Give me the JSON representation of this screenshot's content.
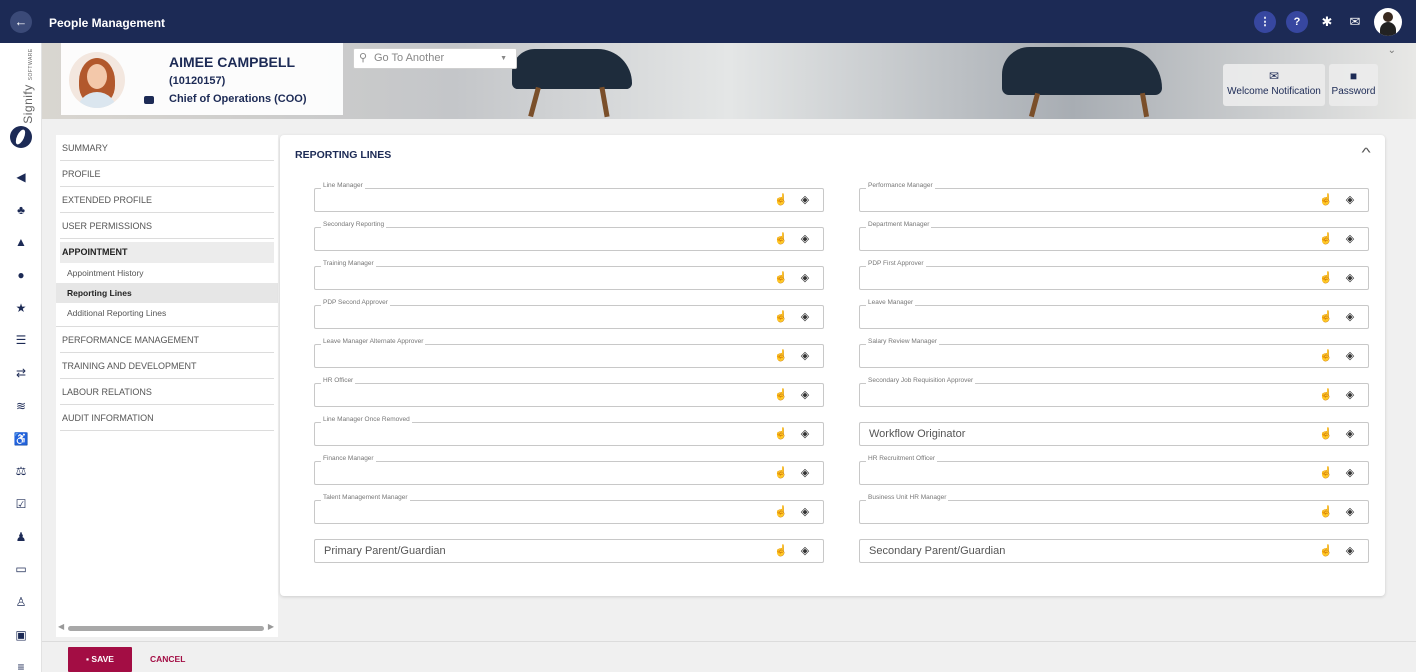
{
  "app": {
    "title": "People Management",
    "back_icon": "arrow-left-icon"
  },
  "topbar": {
    "icons": [
      "more-vert-icon",
      "help-icon",
      "gear-icon",
      "mail-icon",
      "user-avatar"
    ],
    "more_glyph": "⋮",
    "help_glyph": "?"
  },
  "brand": {
    "name": "Signify",
    "sub": "SOFTWARE"
  },
  "rail": {
    "items": [
      "megaphone-icon",
      "org-chart-icon",
      "graduation-icon",
      "dashboard-icon",
      "star-icon",
      "sliders-icon",
      "transfer-icon",
      "handshake-icon",
      "wheelchair-icon",
      "scales-icon",
      "checkbox-icon",
      "user-tie-icon",
      "laptop-icon",
      "user-plus-icon",
      "id-badge-icon",
      "list-icon"
    ]
  },
  "employee": {
    "name": "AIMEE CAMPBELL",
    "id": "(10120157)",
    "title": "Chief of Operations (COO)"
  },
  "search": {
    "placeholder": "Go To Another"
  },
  "header_buttons": {
    "welcome": "Welcome Notification",
    "password": "Password"
  },
  "menu": {
    "items_top": [
      "SUMMARY",
      "PROFILE",
      "EXTENDED PROFILE",
      "USER PERMISSIONS"
    ],
    "active_group": "APPOINTMENT",
    "sub_items": [
      "Appointment History",
      "Reporting Lines",
      "Additional Reporting Lines"
    ],
    "current_sub": "Reporting Lines",
    "items_bottom": [
      "PERFORMANCE MANAGEMENT",
      "TRAINING AND DEVELOPMENT",
      "LABOUR RELATIONS",
      "AUDIT INFORMATION"
    ]
  },
  "section": {
    "title": "REPORTING LINES"
  },
  "fields_left": [
    {
      "label": "Line Manager",
      "placeholder": ""
    },
    {
      "label": "Secondary Reporting",
      "placeholder": ""
    },
    {
      "label": "Training Manager",
      "placeholder": ""
    },
    {
      "label": "PDP Second Approver",
      "placeholder": ""
    },
    {
      "label": "Leave Manager Alternate Approver",
      "placeholder": ""
    },
    {
      "label": "HR Officer",
      "placeholder": ""
    },
    {
      "label": "Line Manager Once Removed",
      "placeholder": ""
    },
    {
      "label": "Finance Manager",
      "placeholder": ""
    },
    {
      "label": "Talent Management Manager",
      "placeholder": ""
    },
    {
      "label": "",
      "placeholder": "Primary Parent/Guardian"
    }
  ],
  "fields_right": [
    {
      "label": "Performance Manager",
      "placeholder": ""
    },
    {
      "label": "Department Manager",
      "placeholder": ""
    },
    {
      "label": "PDP First Approver",
      "placeholder": ""
    },
    {
      "label": "Leave Manager",
      "placeholder": ""
    },
    {
      "label": "Salary Review Manager",
      "placeholder": ""
    },
    {
      "label": "Secondary Job Requisition Approver",
      "placeholder": ""
    },
    {
      "label": "",
      "placeholder": "Workflow Originator"
    },
    {
      "label": "HR Recruitment Officer",
      "placeholder": ""
    },
    {
      "label": "Business Unit HR Manager",
      "placeholder": ""
    },
    {
      "label": "",
      "placeholder": "Secondary Parent/Guardian"
    }
  ],
  "field_actions": {
    "pick_icon": "pointer-hand-icon",
    "clear_icon": "eraser-icon"
  },
  "footer": {
    "save": "SAVE",
    "cancel": "CANCEL"
  }
}
